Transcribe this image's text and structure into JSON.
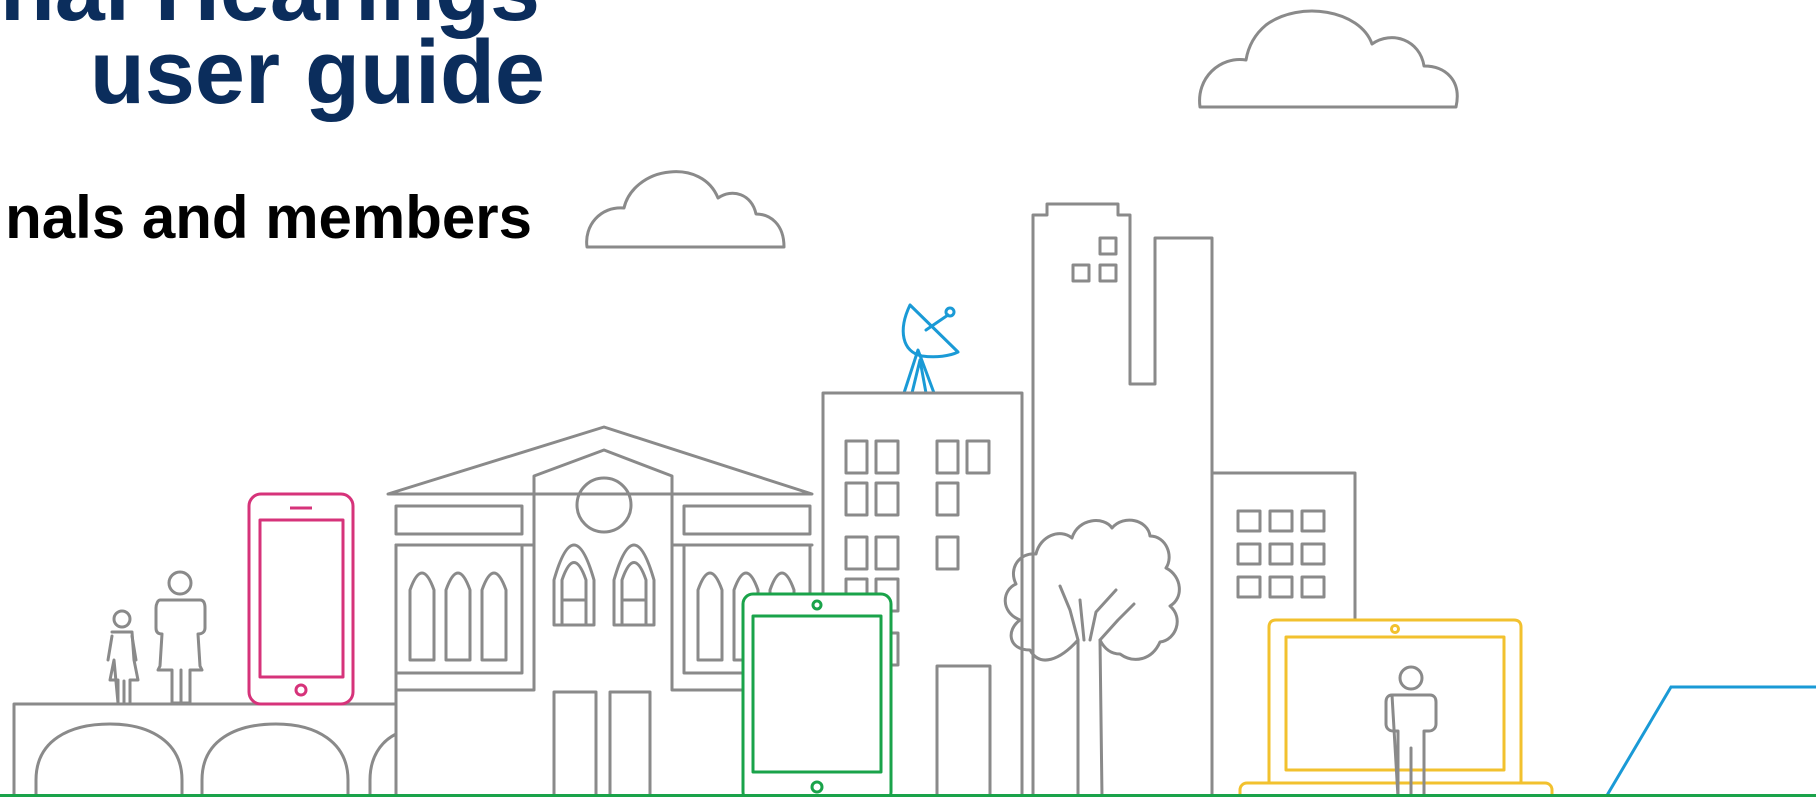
{
  "title": {
    "line1": "unal Hearings",
    "line2": " user guide"
  },
  "subtitle": "nals and members",
  "colors": {
    "title": "#0b2d5c",
    "line_gray": "#8a8a8a",
    "phone": "#d6337a",
    "tablet": "#1aa34a",
    "laptop": "#f2c12e",
    "dish": "#1a9ad6",
    "accent_line": "#1a9ad6",
    "bottom_strip": "#1aa34a"
  },
  "icons": [
    "cloud-icon",
    "satellite-dish-icon",
    "smartphone-icon",
    "tablet-icon",
    "laptop-icon",
    "person-icon",
    "child-icon",
    "tree-icon"
  ]
}
